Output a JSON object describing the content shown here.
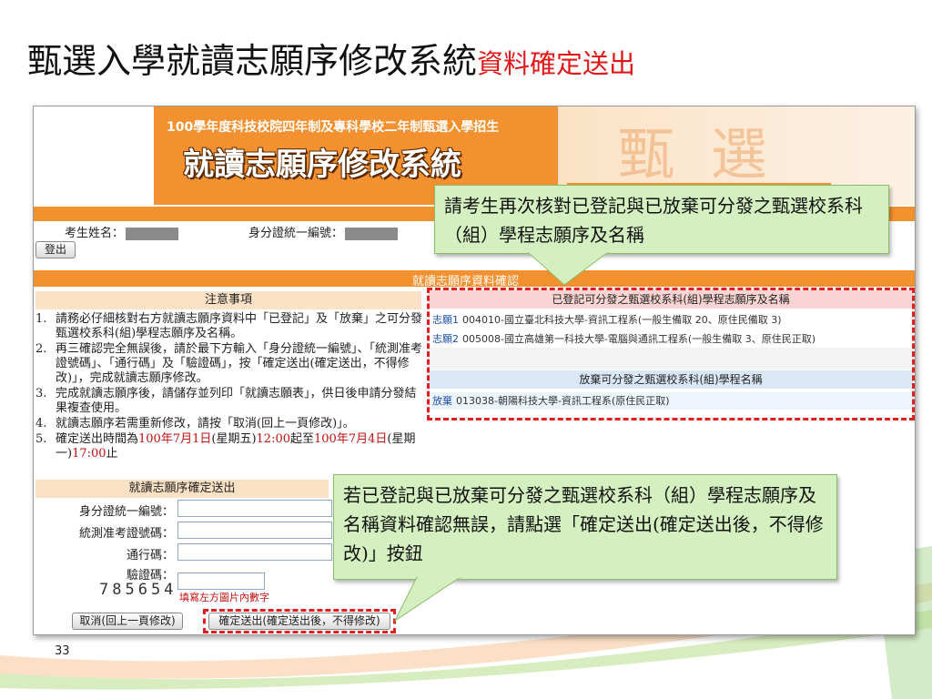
{
  "slide": {
    "title_main": "甄選入學就讀志願序修改系統",
    "title_suffix": "資料確定送出",
    "page_number": "33"
  },
  "header": {
    "top_line": "100學年度科技校院四年制及專科學校二年制甄選入學招生",
    "main_title": "就讀志願序修改系統",
    "watermark": "甄 選"
  },
  "user_info": {
    "name_label": "考生姓名：",
    "id_label": "身分證統一編號：",
    "logout_label": "登出"
  },
  "section_title": "就讀志願序資料確認",
  "notes": {
    "heading": "注意事項",
    "items": [
      {
        "num": "1.",
        "text": "請務必仔細核對右方就讀志願序資料中「已登記」及「放棄」之可分發甄選校系科(組)學程志願序及名稱。"
      },
      {
        "num": "2.",
        "text": "再三確認完全無誤後，請於最下方輸入「身分證統一編號」、「統測准考證號碼」、「通行碼」及「驗證碼」，按「確定送出(確定送出，不得修改)」，完成就讀志願序修改。"
      },
      {
        "num": "3.",
        "text": "完成就讀志願序後，請儲存並列印「就讀志願表」，供日後申請分發結果複查使用。"
      },
      {
        "num": "4.",
        "text": "就讀志願序若需重新修改，請按「取消(回上一頁修改)」。"
      }
    ],
    "deadline": {
      "num": "5.",
      "prefix": "確定送出時間為",
      "start_date": "100年7月1日",
      "start_day": "(星期五)",
      "start_time": "12:00",
      "mid": "起至",
      "end_date": "100年7月4日",
      "end_day": "(星期一)",
      "end_time": "17:00",
      "suffix": "止"
    }
  },
  "confirm_form": {
    "heading": "就讀志願序確定送出",
    "fields": {
      "id_label": "身分證統一編號：",
      "exam_label": "統測准考證號碼：",
      "pass_label": "通行碼：",
      "verify_label": "驗證碼："
    },
    "captcha_digits": "785654",
    "captcha_hint": "填寫左方圖片內數字",
    "cancel_label": "取消(回上一頁修改)",
    "submit_label": "確定送出(確定送出後，不得修改)"
  },
  "choices_panel": {
    "registered_heading": "已登記可分發之甄選校系科(組)學程志願序及名稱",
    "registered": [
      {
        "tag": "志願1",
        "text": "004010-國立臺北科技大學-資訊工程系(一般生備取 20、原住民備取 3)"
      },
      {
        "tag": "志願2",
        "text": "005008-國立高雄第一科技大學-電腦與通訊工程系(一般生備取 3、原住民正取)"
      }
    ],
    "abandoned_heading": "放棄可分發之甄選校系科(組)學程名稱",
    "abandoned": [
      {
        "tag": "放棄",
        "text": "013038-朝陽科技大學-資訊工程系(原住民正取)"
      }
    ]
  },
  "callouts": {
    "verify_text": "請考生再次核對已登記與已放棄可分發之甄選校系科（組）學程志願序及名稱",
    "submit_text": "若已登記與已放棄可分發之甄選校系科（組）學程志願序及名稱資料確認無誤，請點選「確定送出(確定送出後，不得修改)」按鈕"
  },
  "colors": {
    "accent_orange": "#f3902f",
    "highlight_red": "#e02020",
    "callout_green": "#d5f0c0"
  }
}
